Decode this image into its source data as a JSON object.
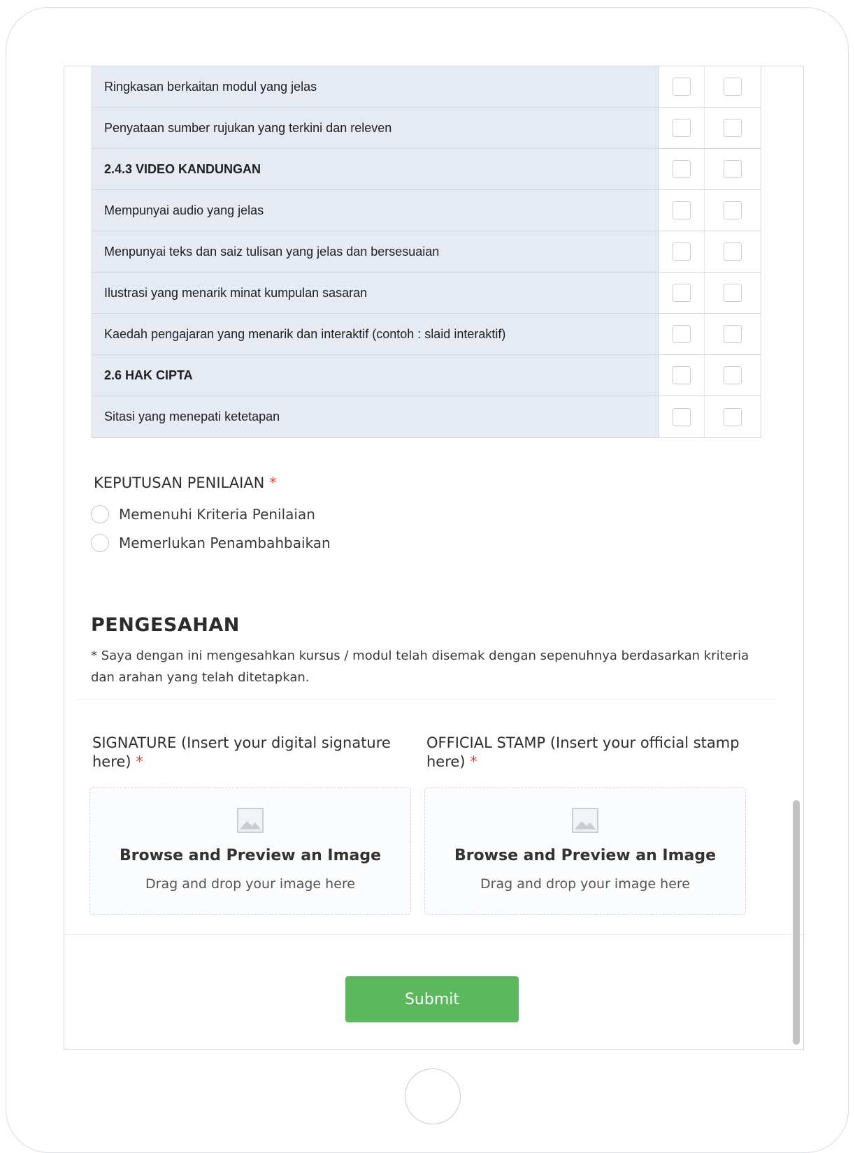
{
  "matrix": {
    "rows": [
      {
        "label": "Ringkasan berkaitan modul yang jelas",
        "bold": false
      },
      {
        "label": "Penyataan sumber rujukan yang terkini dan releven",
        "bold": false
      },
      {
        "label": "2.4.3 VIDEO KANDUNGAN",
        "bold": true
      },
      {
        "label": "Mempunyai audio yang jelas",
        "bold": false
      },
      {
        "label": "Menpunyai teks dan saiz tulisan yang jelas dan bersesuaian",
        "bold": false
      },
      {
        "label": "Ilustrasi yang menarik minat kumpulan sasaran",
        "bold": false
      },
      {
        "label": "Kaedah pengajaran yang menarik dan interaktif (contoh : slaid interaktif)",
        "bold": false
      },
      {
        "label": "2.6 HAK CIPTA",
        "bold": true
      },
      {
        "label": "Sitasi yang menepati ketetapan",
        "bold": false
      }
    ]
  },
  "decision": {
    "label": "KEPUTUSAN PENILAIAN",
    "required_mark": "*",
    "options": [
      "Memenuhi Kriteria Penilaian",
      "Memerlukan Penambahbaikan"
    ]
  },
  "pengesahan": {
    "title": "PENGESAHAN",
    "text": "* Saya dengan ini mengesahkan kursus / modul telah disemak dengan sepenuhnya berdasarkan kriteria dan arahan yang telah ditetapkan."
  },
  "uploads": {
    "signature": {
      "label": "SIGNATURE (Insert your digital signature here)",
      "required_mark": "*",
      "title": "Browse and Preview an Image",
      "subtitle": "Drag and drop your image here"
    },
    "stamp": {
      "label": "OFFICIAL STAMP (Insert your official stamp here)",
      "required_mark": "*",
      "title": "Browse and Preview an Image",
      "subtitle": "Drag and drop your image here"
    }
  },
  "submit": {
    "label": "Submit",
    "color": "#5cb85c"
  },
  "icons": {
    "image_placeholder": "image-icon"
  }
}
